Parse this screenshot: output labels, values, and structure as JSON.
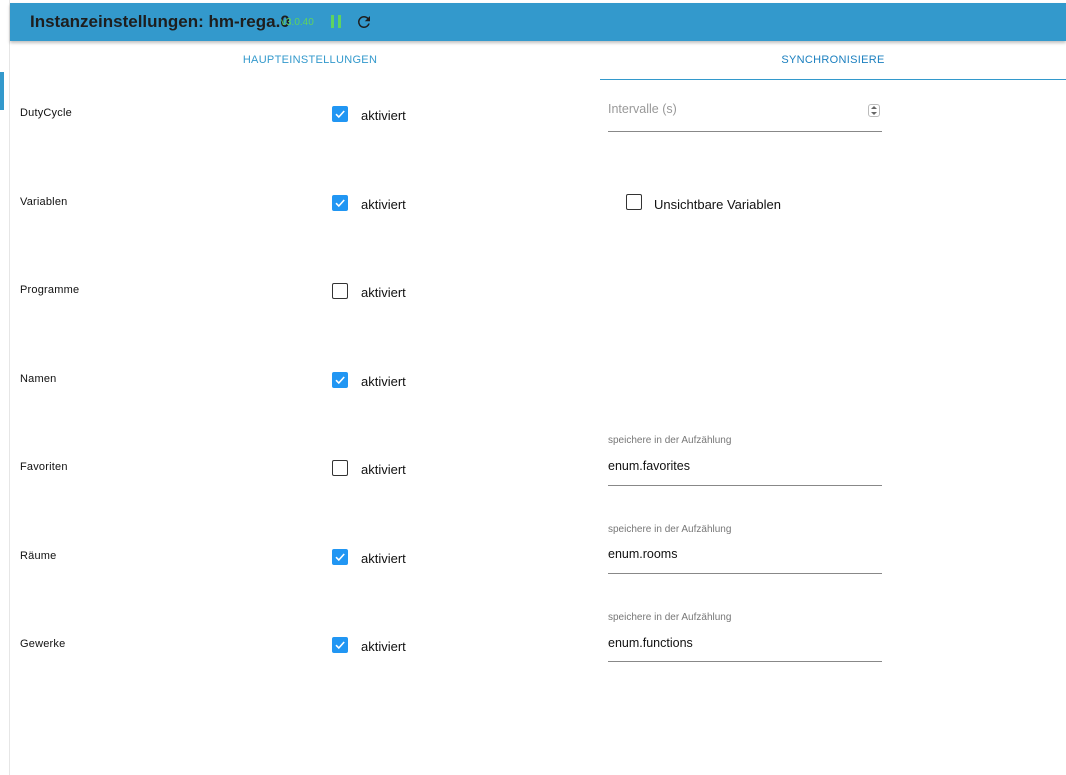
{
  "header": {
    "title": "Instanzeinstellungen: hm-rega.0",
    "version": "v3.0.40",
    "status_icon": "pause-icon",
    "reload_icon": "reload-icon",
    "status_color": "#5fd35f",
    "accent": "#3399cc"
  },
  "tabs": [
    {
      "label": "HAUPTEINSTELLUNGEN",
      "selected": false
    },
    {
      "label": "SYNCHRONISIERE",
      "selected": true
    }
  ],
  "checkbox_label": "aktiviert",
  "rows": [
    {
      "label": "DutyCycle",
      "checked": true
    },
    {
      "label": "Variablen",
      "checked": true
    },
    {
      "label": "Programme",
      "checked": false
    },
    {
      "label": "Namen",
      "checked": true
    },
    {
      "label": "Favoriten",
      "checked": false
    },
    {
      "label": "Räume",
      "checked": true
    },
    {
      "label": "Gewerke",
      "checked": true
    }
  ],
  "interval_field": {
    "placeholder": "Intervalle (s)"
  },
  "invisible_vars": {
    "label": "Unsichtbare Variablen",
    "checked": false
  },
  "enum_fields": [
    {
      "caption": "speichere in der Aufzählung",
      "value": "enum.favorites"
    },
    {
      "caption": "speichere in der Aufzählung",
      "value": "enum.rooms"
    },
    {
      "caption": "speichere in der Aufzählung",
      "value": "enum.functions"
    }
  ]
}
